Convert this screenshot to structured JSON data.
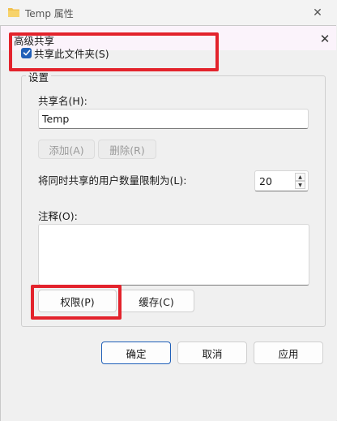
{
  "parent_window": {
    "title": "Temp 属性",
    "close_glyph": "✕"
  },
  "dialog": {
    "title": "高级共享",
    "close_glyph": "✕",
    "share_checkbox": {
      "label": "共享此文件夹(S)",
      "checked": true
    },
    "settings_group": {
      "title": "设置",
      "share_name_label": "共享名(H):",
      "share_name_value": "Temp",
      "add_button": "添加(A)",
      "remove_button": "删除(R)",
      "user_limit_label": "将同时共享的用户数量限制为(L):",
      "user_limit_value": "20",
      "comment_label": "注释(O):",
      "comment_value": "",
      "permissions_button": "权限(P)",
      "caching_button": "缓存(C)"
    },
    "footer": {
      "ok_button": "确定",
      "cancel_button": "取消",
      "apply_button": "应用"
    }
  },
  "colors": {
    "accent": "#1f5fb8",
    "highlight": "#e3232c",
    "folder": "#f2c14e"
  }
}
